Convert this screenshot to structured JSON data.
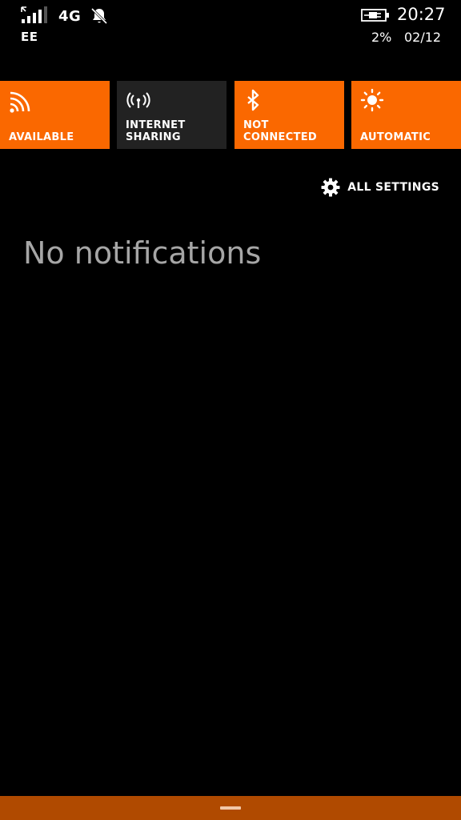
{
  "status_bar": {
    "signal_icon": "signal-strength-icon",
    "network_type": "4G",
    "silent_icon": "bell-off-icon",
    "carrier": "EE",
    "battery_icon": "battery-charging-icon",
    "time": "20:27",
    "battery_percent": "2%",
    "date": "02/12"
  },
  "tiles": [
    {
      "label": "AVAILABLE",
      "icon": "wifi-icon",
      "state": "on"
    },
    {
      "label": "INTERNET\nSHARING",
      "icon": "internet-sharing-icon",
      "state": "off"
    },
    {
      "label": "NOT CONNECTED",
      "icon": "bluetooth-icon",
      "state": "on"
    },
    {
      "label": "AUTOMATIC",
      "icon": "brightness-icon",
      "state": "on"
    }
  ],
  "all_settings": {
    "label": "ALL SETTINGS",
    "icon": "gear-icon"
  },
  "notifications": {
    "empty_text": "No notifications"
  },
  "colors": {
    "accent": "#fa6800",
    "tile_off": "#222222",
    "background": "#000000",
    "bottom_bar": "#b04a00",
    "muted_text": "#a6a6a6"
  }
}
